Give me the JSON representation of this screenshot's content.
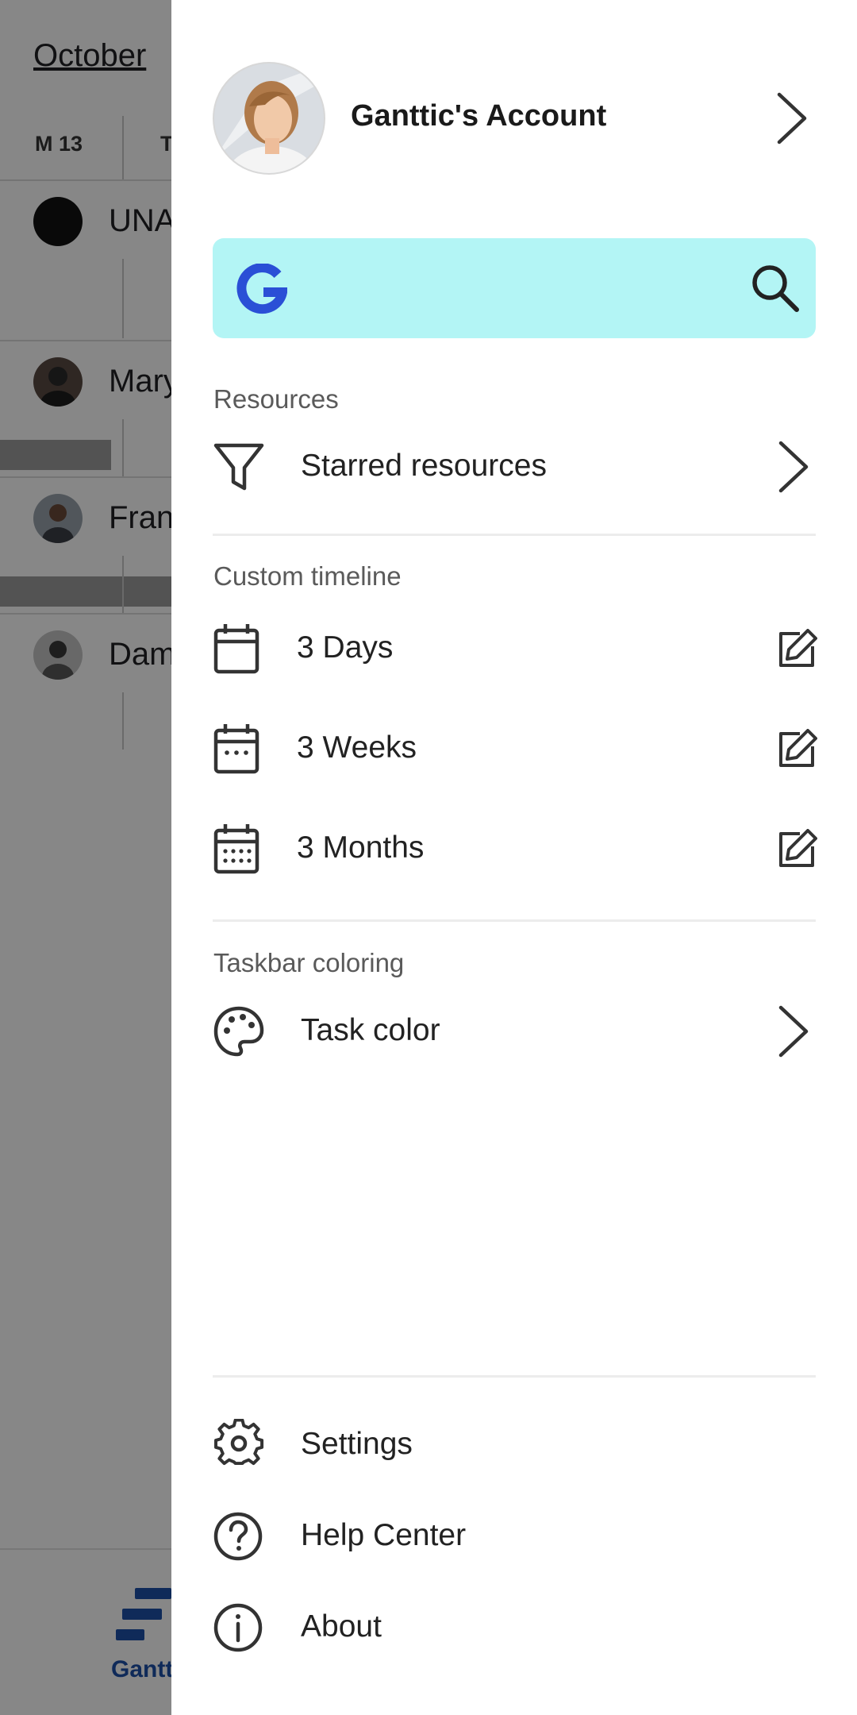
{
  "background": {
    "month": "October",
    "day_headers": [
      "M 13",
      "T"
    ],
    "rows": [
      {
        "name": "UNA"
      },
      {
        "name": "Mary"
      },
      {
        "name": "Fran"
      },
      {
        "name": "Dam"
      }
    ],
    "bottom_nav": {
      "gantt_label": "Gantt"
    }
  },
  "drawer": {
    "account": {
      "name": "Ganttic's Account",
      "icon": "chevron-right-icon"
    },
    "search": {
      "logo_icon": "g-logo-icon",
      "icon": "search-icon",
      "background": "#b3f5f5"
    },
    "resources": {
      "section_label": "Resources",
      "items": [
        {
          "label": "Starred resources",
          "icon": "filter-icon"
        }
      ]
    },
    "custom_timeline": {
      "section_label": "Custom timeline",
      "items": [
        {
          "label": "3 Days",
          "icon": "calendar-blank-icon"
        },
        {
          "label": "3 Weeks",
          "icon": "calendar-week-icon"
        },
        {
          "label": "3 Months",
          "icon": "calendar-month-icon"
        }
      ]
    },
    "taskbar_coloring": {
      "section_label": "Taskbar coloring",
      "items": [
        {
          "label": "Task color",
          "icon": "palette-icon"
        }
      ]
    },
    "footer": {
      "items": [
        {
          "label": "Settings",
          "icon": "gear-icon"
        },
        {
          "label": "Help Center",
          "icon": "help-circle-icon"
        },
        {
          "label": "About",
          "icon": "info-circle-icon"
        }
      ]
    }
  },
  "colors": {
    "accent": "#1e50a8",
    "search_bg": "#b3f5f5",
    "scrim": "rgba(0,0,0,0.47)"
  }
}
